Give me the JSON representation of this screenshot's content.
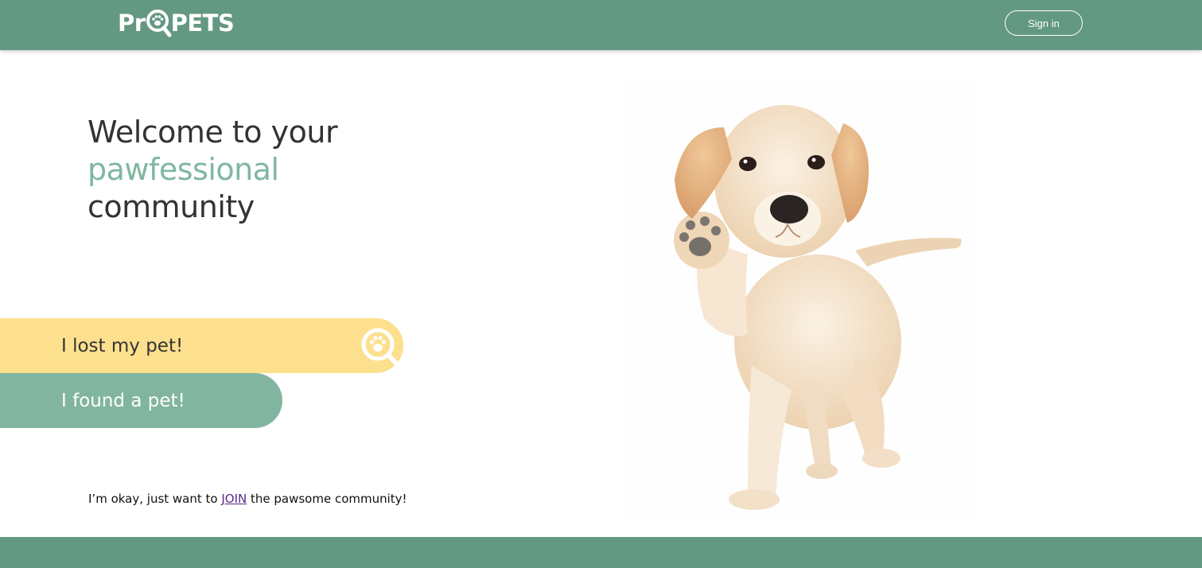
{
  "header": {
    "logo": {
      "text_before": "Pr",
      "text_after": "PETS",
      "icon": "magnifier-paw-icon"
    },
    "signin_label": "Sign in"
  },
  "hero": {
    "line1": "Welcome to your",
    "line2": "pawfessional",
    "line3": "community"
  },
  "actions": {
    "lost_label": "I lost my pet!",
    "lost_icon": "magnifier-paw-icon",
    "found_label": "I found a pet!",
    "join_prefix": "I’m okay, just want to ",
    "join_link": "JOIN",
    "join_suffix": " the pawsome community!"
  },
  "image": {
    "subject": "puppy-waving-paw"
  },
  "colors": {
    "header_bg": "#639883",
    "accent_text": "#7fb7a0",
    "lost_bg": "#fde08e",
    "found_bg": "#81b5a0"
  }
}
